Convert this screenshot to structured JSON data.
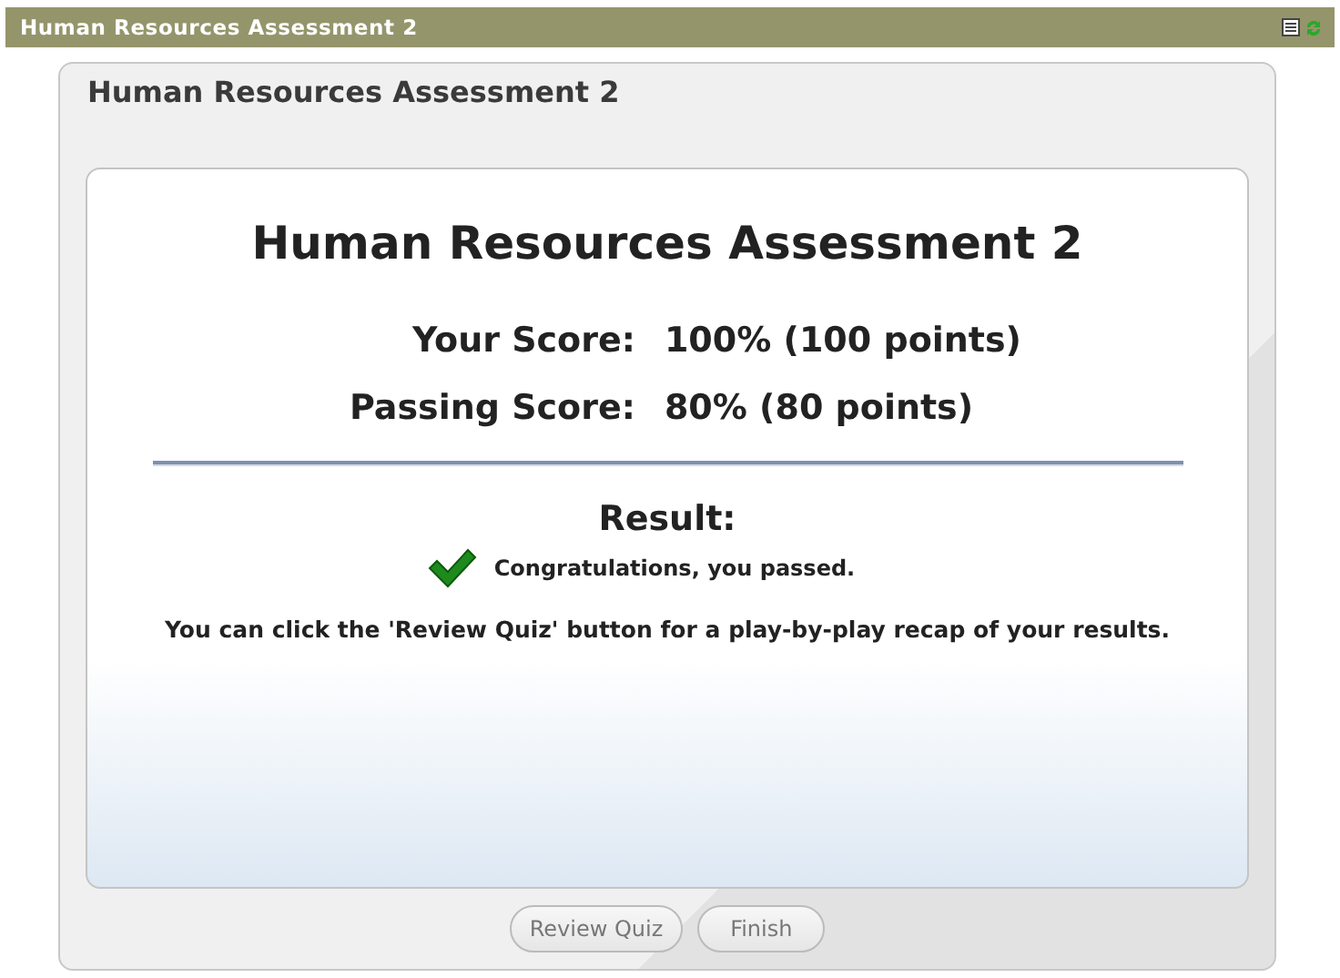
{
  "window": {
    "title": "Human Resources Assessment 2"
  },
  "panel": {
    "title": "Human Resources Assessment 2"
  },
  "card": {
    "title": "Human Resources Assessment 2",
    "scores": [
      {
        "label": "Your Score:",
        "value": "100% (100 points)"
      },
      {
        "label": "Passing Score:",
        "value": "80% (80 points)"
      }
    ],
    "result_label": "Result:",
    "passed": true,
    "result_message": "Congratulations, you passed.",
    "hint": "You can click the 'Review Quiz' button for a play-by-play recap of your results."
  },
  "buttons": [
    "Review Quiz",
    "Finish"
  ]
}
